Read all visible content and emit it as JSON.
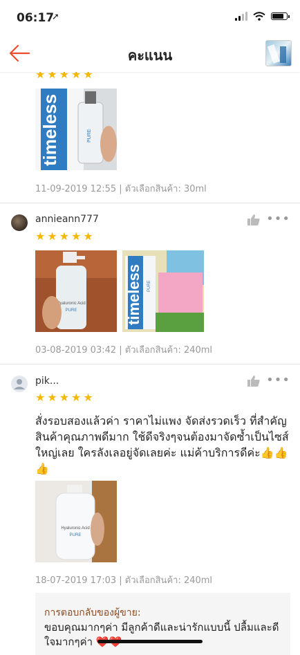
{
  "status": {
    "time": "06:17",
    "location_icon": "location-arrow-icon"
  },
  "header": {
    "title": "คะแนน"
  },
  "reviews": [
    {
      "stars": 5,
      "meta": "11-09-2019 12:55 | ตัวเลือกสินค้า: 30ml",
      "photo_texts": [
        "timeless",
        "PURE"
      ]
    },
    {
      "username": "annieann777",
      "stars": 5,
      "meta": "03-08-2019 03:42 | ตัวเลือกสินค้า: 240ml",
      "photo_texts": [
        "Hyaluronic Acid",
        "PURE",
        "timeless",
        "PURE"
      ]
    },
    {
      "username": "pik...",
      "stars": 5,
      "comment": "สั่งรอบสองแล้วค่า ราคาไม่แพง จัดส่งรวดเร็ว ที่สำคัญ สินค้าคุณภาพดีมาก ใช้ดีจริงๆจนต้องมาจัดซ้ำเป็นไซส์ใหญ่เลย ใครลังเลอยู่จัดเลยค่ะ แม่ค้าบริการดีค่ะ👍👍👍",
      "meta": "18-07-2019 17:03 | ตัวเลือกสินค้า: 240ml",
      "photo_texts": [
        "Hyaluronic Acid",
        "PURE"
      ],
      "seller_reply": {
        "label": "การตอบกลับของผู้ขาย:",
        "text": "ขอบคุณมากๆค่า มีลูกค้าดีและน่ารักแบบนี้ ปลื้มและดีใจมากๆค่า ❤️❤️"
      }
    }
  ],
  "colors": {
    "accent": "#ee4d2d",
    "star": "#f5b800",
    "reply_label": "#8b4a1f"
  }
}
